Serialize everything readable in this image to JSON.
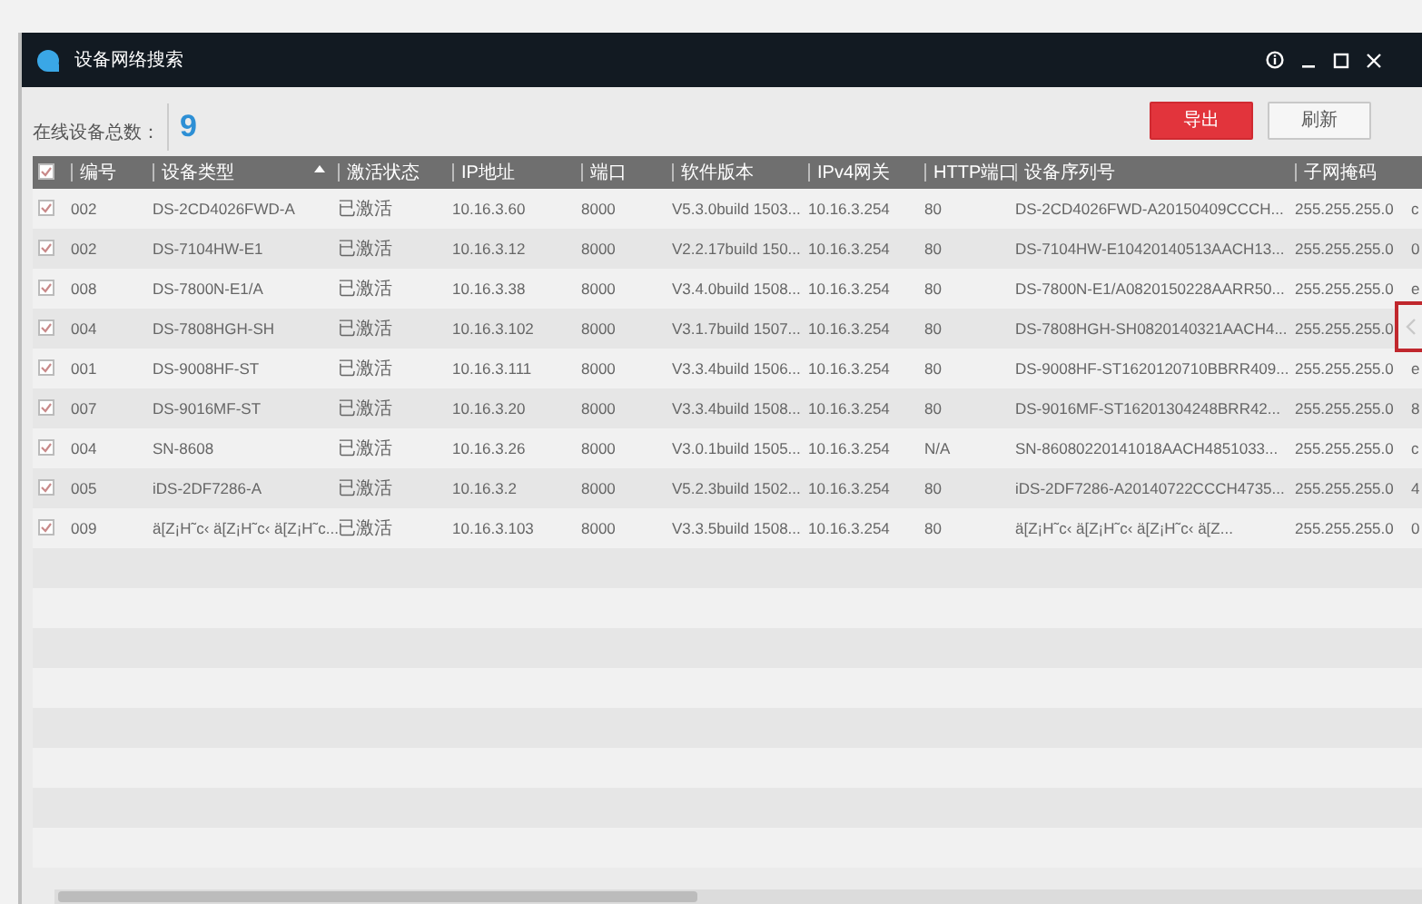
{
  "window": {
    "title": "设备网络搜索"
  },
  "summary": {
    "label": "在线设备总数：",
    "count": "9"
  },
  "buttons": [
    {
      "kind": "primary",
      "label": "导出"
    },
    {
      "kind": "secondary",
      "label": "刷新"
    }
  ],
  "table": {
    "select_all_checked": true,
    "columns": [
      {
        "label": "编号"
      },
      {
        "label": "设备类型",
        "sorted": true
      },
      {
        "label": "激活状态"
      },
      {
        "label": "IP地址"
      },
      {
        "label": "端口"
      },
      {
        "label": "软件版本"
      },
      {
        "label": "IPv4网关"
      },
      {
        "label": "HTTP端口"
      },
      {
        "label": "设备序列号"
      },
      {
        "label": "子网掩码"
      },
      {}
    ],
    "rows": [
      {
        "checked": true,
        "cells": [
          "002",
          "DS-2CD4026FWD-A",
          "已激活",
          "10.16.3.60",
          "8000",
          "V5.3.0build 1503...",
          "10.16.3.254",
          "80",
          "DS-2CD4026FWD-A20150409CCCH...",
          "255.255.255.0",
          "c"
        ]
      },
      {
        "checked": true,
        "cells": [
          "002",
          "DS-7104HW-E1",
          "已激活",
          "10.16.3.12",
          "8000",
          "V2.2.17build 150...",
          "10.16.3.254",
          "80",
          "DS-7104HW-E10420140513AACH13...",
          "255.255.255.0",
          "0"
        ]
      },
      {
        "checked": true,
        "cells": [
          "008",
          "DS-7800N-E1/A",
          "已激活",
          "10.16.3.38",
          "8000",
          "V3.4.0build 1508...",
          "10.16.3.254",
          "80",
          "DS-7800N-E1/A0820150228AARR50...",
          "255.255.255.0",
          "e"
        ]
      },
      {
        "checked": true,
        "cells": [
          "004",
          "DS-7808HGH-SH",
          "已激活",
          "10.16.3.102",
          "8000",
          "V3.1.7build 1507...",
          "10.16.3.254",
          "80",
          "DS-7808HGH-SH0820140321AACH4...",
          "255.255.255.0",
          ""
        ]
      },
      {
        "checked": true,
        "cells": [
          "001",
          "DS-9008HF-ST",
          "已激活",
          "10.16.3.111",
          "8000",
          "V3.3.4build 1506...",
          "10.16.3.254",
          "80",
          "DS-9008HF-ST1620120710BBRR409...",
          "255.255.255.0",
          "e"
        ]
      },
      {
        "checked": true,
        "cells": [
          "007",
          "DS-9016MF-ST",
          "已激活",
          "10.16.3.20",
          "8000",
          "V3.3.4build 1508...",
          "10.16.3.254",
          "80",
          "DS-9016MF-ST16201304248BRR42...",
          "255.255.255.0",
          "8"
        ]
      },
      {
        "checked": true,
        "cells": [
          "004",
          "SN-8608",
          "已激活",
          "10.16.3.26",
          "8000",
          "V3.0.1build 1505...",
          "10.16.3.254",
          "N/A",
          "SN-86080220141018AACH4851033...",
          "255.255.255.0",
          "c"
        ]
      },
      {
        "checked": true,
        "cells": [
          "005",
          "iDS-2DF7286-A",
          "已激活",
          "10.16.3.2",
          "8000",
          "V5.2.3build 1502...",
          "10.16.3.254",
          "80",
          "iDS-2DF7286-A20140722CCCH4735...",
          "255.255.255.0",
          "4"
        ]
      },
      {
        "checked": true,
        "cells": [
          "009",
          "ä[Z¡H˜c‹ ä[Z¡H˜c‹ ä[Z¡H˜c...",
          "已激活",
          "10.16.3.103",
          "8000",
          "V3.3.5build 1508...",
          "10.16.3.254",
          "80",
          "ä[Z¡H˜c‹ ä[Z¡H˜c‹ ä[Z¡H˜c‹ ä[Z...",
          "255.255.255.0",
          "0"
        ]
      }
    ]
  }
}
